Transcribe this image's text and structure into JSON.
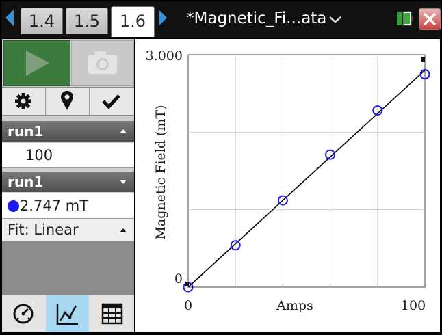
{
  "tabs": [
    {
      "label": "1.4",
      "active": false
    },
    {
      "label": "1.5",
      "active": false
    },
    {
      "label": "1.6",
      "active": true
    }
  ],
  "document": {
    "title": "*Magnetic_Fi...ata"
  },
  "icons": {
    "tab_left": "left-arrow-icon",
    "tab_right": "right-arrow-icon",
    "title_menu": "chevron-down-icon",
    "battery": "battery-icon",
    "close": "close-icon",
    "play": "play-icon",
    "camera": "camera-icon",
    "settings": "gear-icon",
    "marker": "map-pin-icon",
    "check": "check-icon",
    "meter_view": "gauge-icon",
    "graph_view": "graph-icon",
    "table_view": "table-icon"
  },
  "panel": {
    "run_x": {
      "label": "run1",
      "value": "100"
    },
    "run_y": {
      "label": "run1",
      "value": "2.747 mT"
    },
    "fit": "Fit: Linear"
  },
  "colors": {
    "accent_blue": "#1a1aee",
    "play_green": "#3d7a3d",
    "close_red": "#d04040",
    "selected_view": "#a9d8f2"
  },
  "chart_data": {
    "type": "scatter",
    "xlabel": "Amps",
    "ylabel": "Magnetic Field (mT)",
    "xlim": [
      0,
      100
    ],
    "ylim": [
      0,
      3.0
    ],
    "x_ticks": [
      "0",
      "100"
    ],
    "y_ticks": [
      "0",
      "3.000"
    ],
    "grid": true,
    "series": [
      {
        "x": [
          0,
          20,
          40,
          60,
          80,
          100
        ],
        "y": [
          0.0,
          0.54,
          1.12,
          1.71,
          2.28,
          2.747
        ]
      }
    ],
    "fit_line": {
      "type": "linear",
      "x": [
        0,
        100
      ],
      "y": [
        0.0,
        2.8
      ]
    }
  }
}
